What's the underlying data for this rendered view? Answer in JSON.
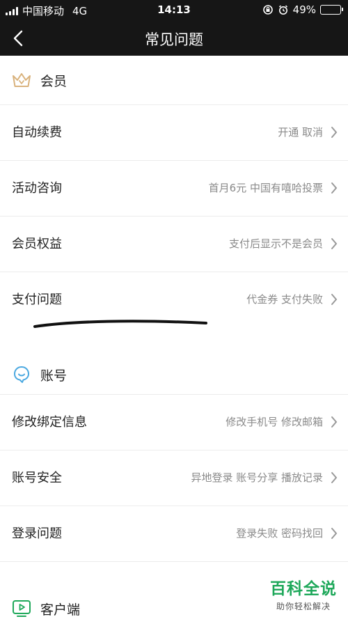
{
  "status_bar": {
    "carrier": "中国移动",
    "network": "4G",
    "time": "14:13",
    "battery_percent_text": "49%",
    "battery_level": 0.49
  },
  "nav": {
    "title": "常见问题",
    "back_icon": "chevron-left-icon"
  },
  "sections": {
    "vip": {
      "title": "会员",
      "icon": "crown-icon",
      "accent": "#d9b27c",
      "rows": [
        {
          "title": "自动续费",
          "desc": "开通 取消"
        },
        {
          "title": "活动咨询",
          "desc": "首月6元 中国有嘻哈投票"
        },
        {
          "title": "会员权益",
          "desc": "支付后显示不是会员"
        },
        {
          "title": "支付问题",
          "desc": "代金券 支付失败"
        }
      ]
    },
    "account": {
      "title": "账号",
      "icon": "user-bubble-icon",
      "accent": "#4aa8e0",
      "rows": [
        {
          "title": "修改绑定信息",
          "desc": "修改手机号 修改邮箱"
        },
        {
          "title": "账号安全",
          "desc": "异地登录 账号分享 播放记录"
        },
        {
          "title": "登录问题",
          "desc": "登录失败 密码找回"
        }
      ]
    },
    "client": {
      "title": "客户端",
      "icon": "tv-play-icon",
      "accent": "#1ea85a"
    }
  },
  "watermark": {
    "title": "百科全说",
    "subtitle": "助你轻松解决",
    "color": "#1ea85a"
  }
}
